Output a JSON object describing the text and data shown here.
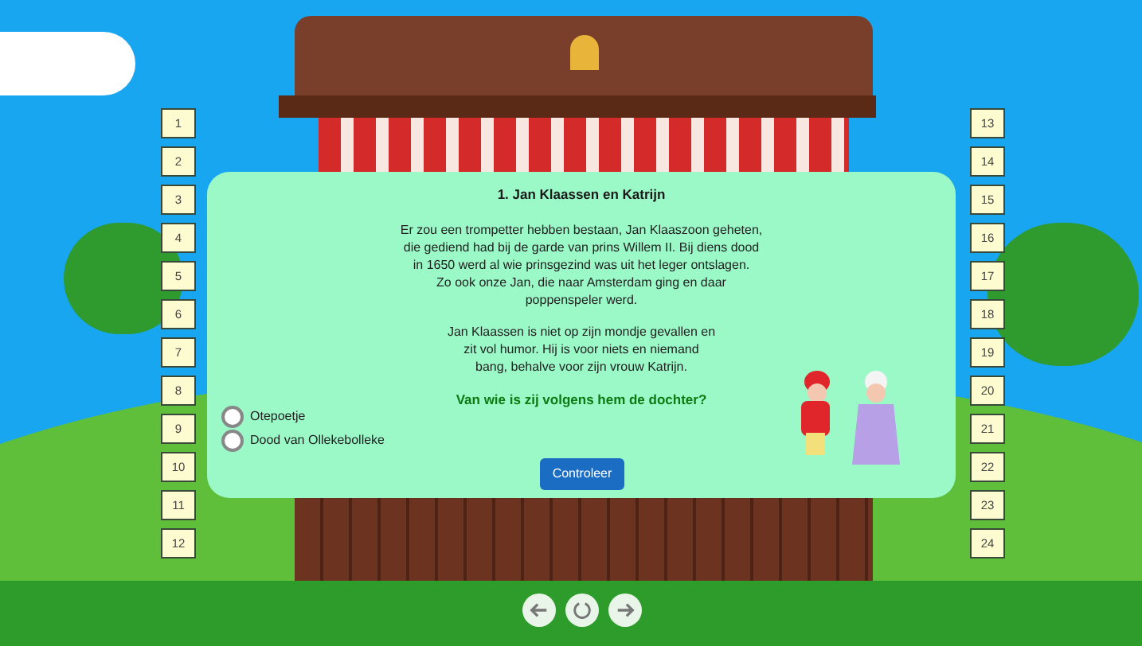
{
  "quiz": {
    "title": "1. Jan Klaassen en Katrijn",
    "paragraphs": [
      "Er zou een trompetter hebben bestaan, Jan Klaaszoon geheten,\ndie gediend had bij de garde van prins Willem II. Bij diens dood\nin 1650 werd al wie prinsgezind was uit het leger ontslagen.\nZo ook onze Jan, die naar Amsterdam ging en daar\npoppenspeler werd.",
      "Jan Klaassen is niet op zijn mondje gevallen en\nzit vol humor. Hij is voor niets en niemand\nbang, behalve voor zijn vrouw Katrijn."
    ],
    "question": "Van wie is zij volgens hem de dochter?",
    "options": [
      {
        "label": "Otepoetje",
        "selected": false
      },
      {
        "label": "Dood van Ollekebolleke",
        "selected": false
      }
    ],
    "button": "Controleer"
  },
  "left_tiles": [
    "1",
    "2",
    "3",
    "4",
    "5",
    "6",
    "7",
    "8",
    "9",
    "10",
    "11",
    "12"
  ],
  "right_tiles": [
    "13",
    "14",
    "15",
    "16",
    "17",
    "18",
    "19",
    "20",
    "21",
    "22",
    "23",
    "24"
  ]
}
